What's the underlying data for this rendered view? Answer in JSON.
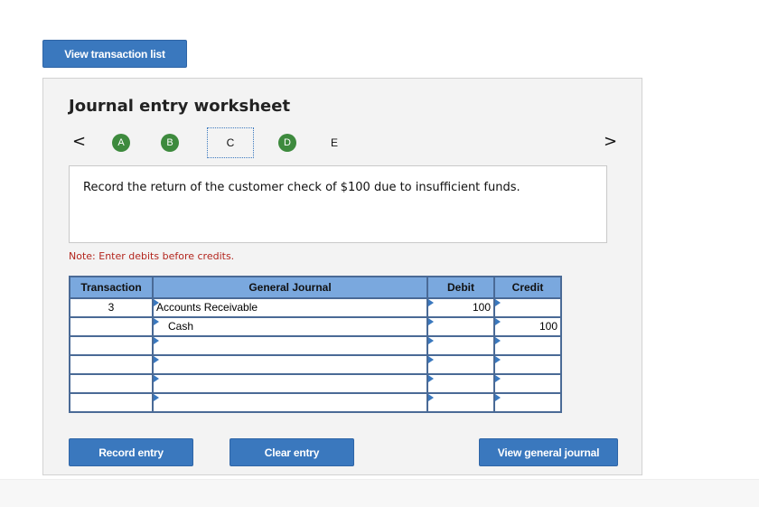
{
  "top_button": "View transaction list",
  "worksheet": {
    "title": "Journal entry worksheet",
    "prev_icon": "<",
    "next_icon": ">",
    "steps": [
      {
        "label": "A",
        "state": "complete"
      },
      {
        "label": "B",
        "state": "complete"
      },
      {
        "label": "C",
        "state": "current"
      },
      {
        "label": "D",
        "state": "complete"
      },
      {
        "label": "E",
        "state": "pending"
      }
    ],
    "prompt": "Record the return of the customer check of $100 due to insufficient funds.",
    "note": "Note: Enter debits before credits."
  },
  "table": {
    "headers": {
      "transaction": "Transaction",
      "general_journal": "General Journal",
      "debit": "Debit",
      "credit": "Credit"
    },
    "rows": [
      {
        "transaction": "3",
        "account": "Accounts Receivable",
        "debit": "100",
        "credit": ""
      },
      {
        "transaction": "",
        "account": "Cash",
        "debit": "",
        "credit": "100"
      },
      {
        "transaction": "",
        "account": "",
        "debit": "",
        "credit": ""
      },
      {
        "transaction": "",
        "account": "",
        "debit": "",
        "credit": ""
      },
      {
        "transaction": "",
        "account": "",
        "debit": "",
        "credit": ""
      },
      {
        "transaction": "",
        "account": "",
        "debit": "",
        "credit": ""
      }
    ]
  },
  "buttons": {
    "record": "Record entry",
    "clear": "Clear entry",
    "view_general_journal": "View general journal"
  },
  "colors": {
    "primary_button": "#3a78be",
    "step_complete": "#3d8a3d",
    "table_header": "#7aa8de",
    "note_text": "#b3261e"
  }
}
